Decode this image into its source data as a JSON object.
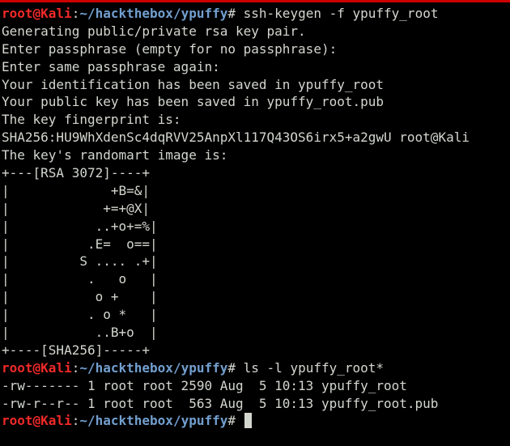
{
  "colors": {
    "background": "#000000",
    "foreground": "#d3d7cf",
    "prompt_user": "#ef2929",
    "prompt_path": "#729fcf",
    "window_accent": "#cc0000"
  },
  "prompt": {
    "user_host": "root@Kali",
    "separator": ":",
    "path": "~/hackthebox/ypuffy",
    "symbol": "# "
  },
  "commands": [
    "ssh-keygen -f ypuffy_root",
    "ls -l ypuffy_root*"
  ],
  "output_keygen": [
    "Generating public/private rsa key pair.",
    "Enter passphrase (empty for no passphrase):",
    "Enter same passphrase again:",
    "Your identification has been saved in ypuffy_root",
    "Your public key has been saved in ypuffy_root.pub",
    "The key fingerprint is:",
    "SHA256:HU9WhXdenSc4dqRVV25AnpXl117Q43OS6irx5+a2gwU root@Kali",
    "The key's randomart image is:",
    "+---[RSA 3072]----+",
    "|             +B=&|",
    "|            +=+@X|",
    "|           ..+o+=%|",
    "|          .E=  o==|",
    "|         S .... .+|",
    "|          .   o   |",
    "|           o +    |",
    "|          . o *   |",
    "|           ..B+o  |",
    "+----[SHA256]-----+"
  ],
  "output_ls": [
    "-rw------- 1 root root 2590 Aug  5 10:13 ypuffy_root",
    "-rw-r--r-- 1 root root  563 Aug  5 10:13 ypuffy_root.pub"
  ],
  "cursor": "block-cursor"
}
